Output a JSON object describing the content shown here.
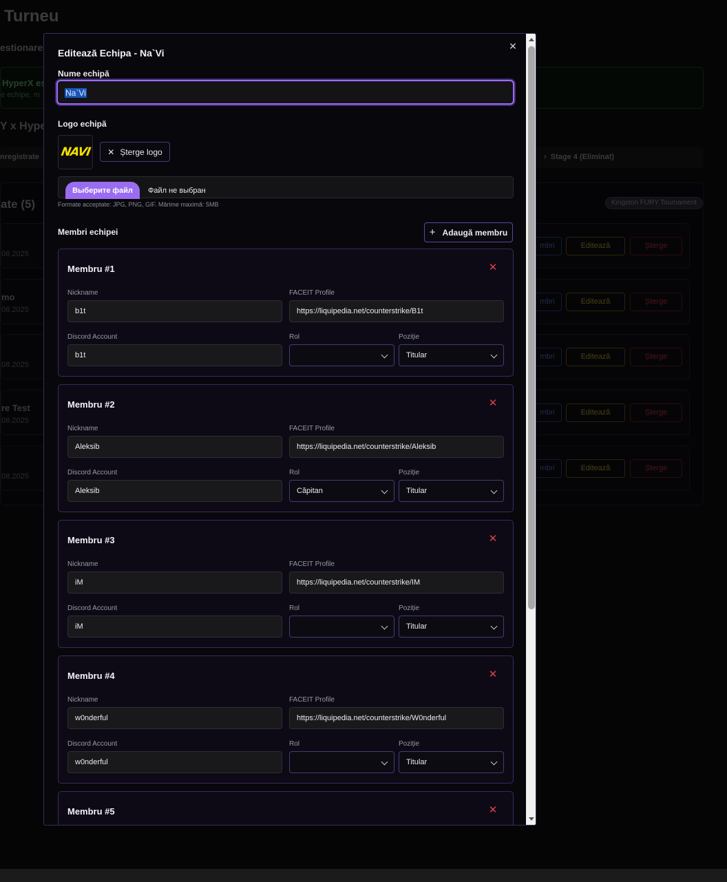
{
  "background": {
    "title": "Turneu",
    "subtitle": "estionare:",
    "notice_title": "HyperX es",
    "notice_text": "e echipe, m",
    "heading": "Y x Hype",
    "tab_left": "nregistrate",
    "tab_right": "Stage 4 (Eliminat)",
    "panel_title": "ate (5)",
    "panel_badge": "Kingston FURY Tournament",
    "rows": [
      {
        "name": "",
        "date": "08.2025"
      },
      {
        "name": "mo",
        "date": "08.2025"
      },
      {
        "name": "",
        "date": "08.2025"
      },
      {
        "name": "re Test",
        "date": "08.2025"
      },
      {
        "name": "",
        "date": "08.2025"
      }
    ],
    "row_buttons": {
      "members": "mbri",
      "edit": "Editează",
      "delete": "Șterge"
    }
  },
  "modal": {
    "title": "Editează Echipa - Na`Vi",
    "close_icon": "✕",
    "team_name_label": "Nume echipă",
    "team_name_value": "Na`Vi",
    "logo_label": "Logo echipă",
    "logo_text": "NAVI",
    "delete_logo": "Șterge logo",
    "file_button": "Выберите файл",
    "file_status": "Файл не выбран",
    "file_hint": "Formate acceptate: JPG, PNG, GIF. Mărime maximă: 5MB",
    "members_label": "Membri echipei",
    "add_member": "Adaugă membru",
    "labels": {
      "nickname": "Nickname",
      "faceit": "FACEIT Profile",
      "discord": "Discord Account",
      "role": "Rol",
      "position": "Poziție"
    },
    "members": [
      {
        "title": "Membru #1",
        "nickname": "b1t",
        "faceit": "https://liquipedia.net/counterstrike/B1t",
        "discord": "b1t",
        "role": "",
        "position": "Titular"
      },
      {
        "title": "Membru #2",
        "nickname": "Aleksib",
        "faceit": "https://liquipedia.net/counterstrike/Aleksib",
        "discord": "Aleksib",
        "role": "Căpitan",
        "position": "Titular"
      },
      {
        "title": "Membru #3",
        "nickname": "iM",
        "faceit": "https://liquipedia.net/counterstrike/IM",
        "discord": "iM",
        "role": "",
        "position": "Titular"
      },
      {
        "title": "Membru #4",
        "nickname": "w0nderful",
        "faceit": "https://liquipedia.net/counterstrike/W0nderful",
        "discord": "w0nderful",
        "role": "",
        "position": "Titular"
      },
      {
        "title": "Membru #5"
      }
    ]
  },
  "colors": {
    "accent": "#9d6bff",
    "danger": "#e0404a",
    "logo_yellow": "#f5e000"
  }
}
